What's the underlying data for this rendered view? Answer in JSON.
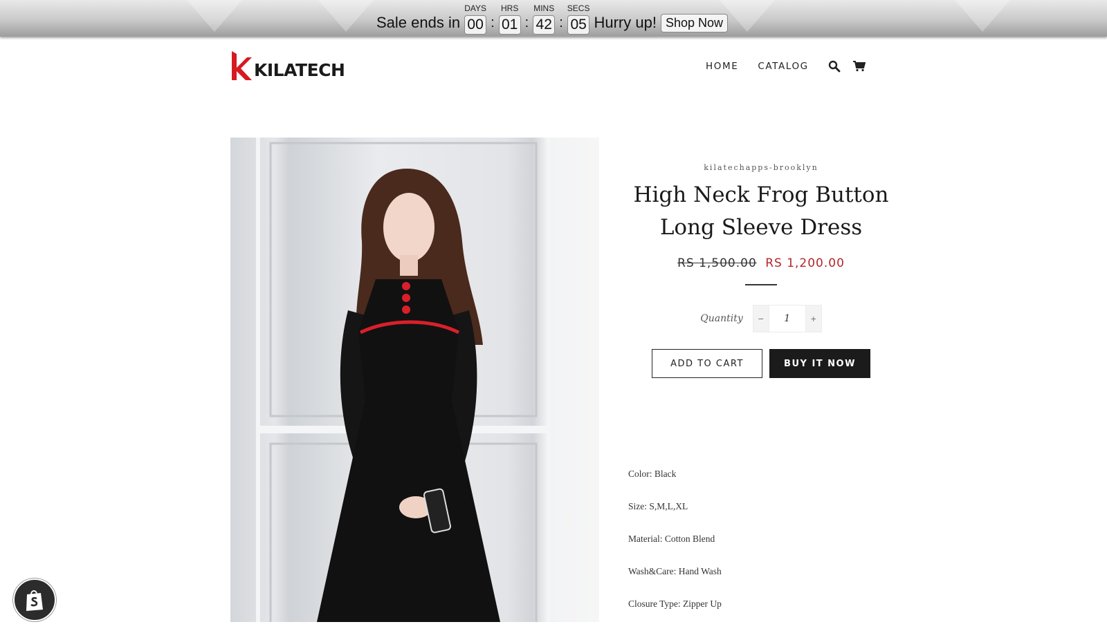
{
  "countdown": {
    "prefix": "Sale ends in",
    "units": [
      {
        "label": "DAYS",
        "value": "00"
      },
      {
        "label": "HRS",
        "value": "01"
      },
      {
        "label": "MINS",
        "value": "42"
      },
      {
        "label": "SECS",
        "value": "05"
      }
    ],
    "separator": ":",
    "suffix": "Hurry up!",
    "button_label": "Shop Now"
  },
  "header": {
    "logo_text": "KILATECH",
    "nav": [
      "HOME",
      "CATALOG"
    ],
    "icons": [
      "search-icon",
      "cart-icon"
    ]
  },
  "product": {
    "vendor": "kilatechapps-brooklyn",
    "title": "High Neck Frog Button Long Sleeve Dress",
    "compare_price": "RS 1,500.00",
    "price": "RS 1,200.00",
    "quantity_label": "Quantity",
    "quantity_value": "1",
    "add_to_cart_label": "ADD TO CART",
    "buy_now_label": "BUY IT NOW",
    "specs": [
      "Color: Black",
      "Size: S,M,L,XL",
      "Material: Cotton Blend",
      "Wash&Care: Hand Wash",
      "Closure Type: Zipper Up"
    ]
  },
  "colors": {
    "accent_red": "#b3262a",
    "logo_red": "#d71920",
    "button_dark": "#1b1b1b"
  }
}
